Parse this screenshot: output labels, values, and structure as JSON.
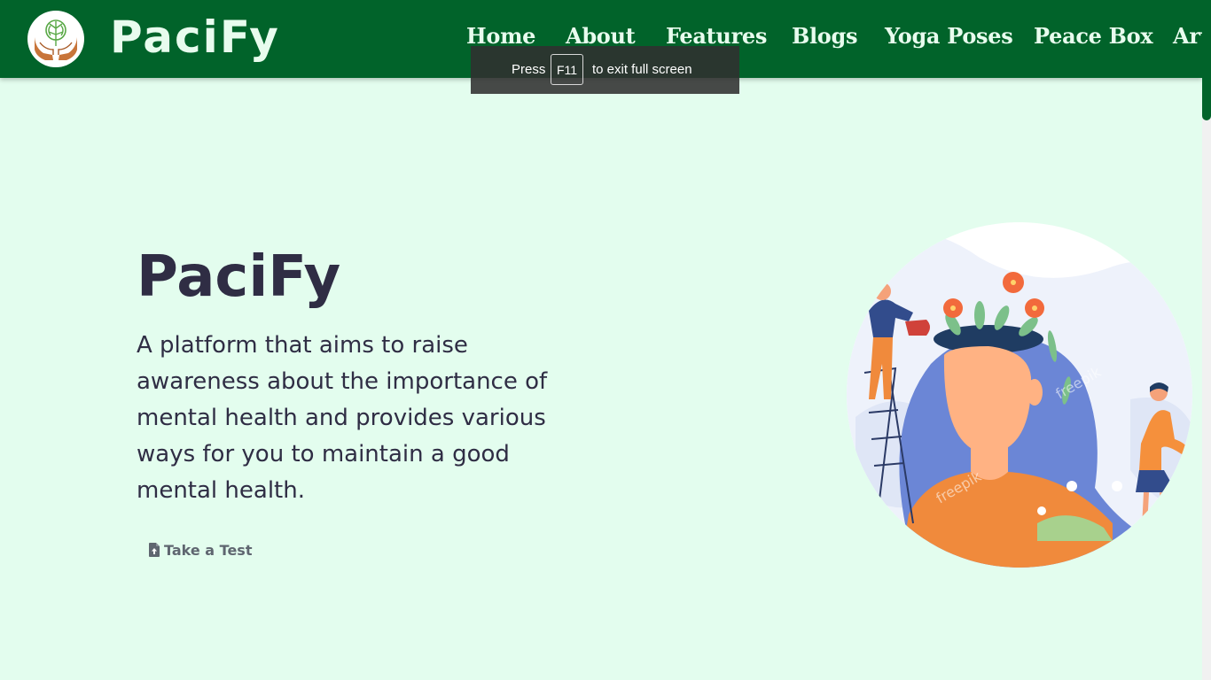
{
  "brand": {
    "name": "PaciFy"
  },
  "nav": {
    "links": [
      "Home",
      "About",
      "Features",
      "Blogs",
      "Yoga Poses",
      "Peace Box",
      "Art"
    ]
  },
  "fullscreen_notice": {
    "before": "Press",
    "key": "F11",
    "after": "to exit full screen"
  },
  "hero": {
    "title": "PaciFy",
    "description": "A platform that aims to raise awareness about the importance of mental health and provides various ways for you to maintain a good mental health.",
    "cta_label": "Take a Test",
    "illustration_watermark": "freepik"
  },
  "colors": {
    "navbar": "#01632a",
    "page_background": "#e3fdee",
    "heading": "#2f2d44",
    "button_text": "#5f6670"
  },
  "icons": {
    "logo": "brain-tree-in-hands-icon",
    "cta": "file-upload-icon"
  }
}
